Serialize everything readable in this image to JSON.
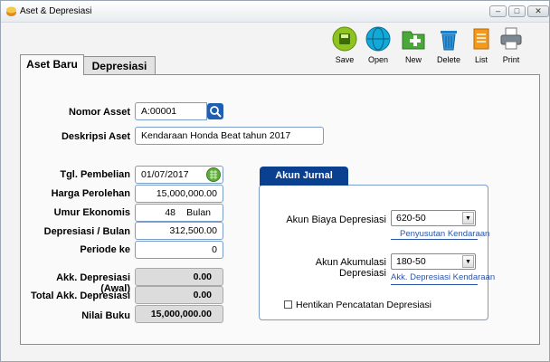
{
  "window": {
    "title": "Aset & Depresiasi"
  },
  "toolbar": {
    "save": "Save",
    "open": "Open",
    "new": "New",
    "delete": "Delete",
    "list": "List",
    "print": "Print"
  },
  "tabs": {
    "aset_baru": "Aset Baru",
    "depresiasi": "Depresiasi"
  },
  "form": {
    "nomor_asset": {
      "label": "Nomor Asset",
      "value": "A:00001"
    },
    "deskripsi_aset": {
      "label": "Deskripsi Aset",
      "value": "Kendaraan Honda Beat tahun 2017"
    },
    "tgl_pembelian": {
      "label": "Tgl. Pembelian",
      "value": "01/07/2017"
    },
    "harga_perolehan": {
      "label": "Harga Perolehan",
      "value": "15,000,000.00"
    },
    "umur_ekonomis": {
      "label": "Umur Ekonomis",
      "value": "48",
      "unit": "Bulan"
    },
    "depresiasi_bulan": {
      "label": "Depresiasi / Bulan",
      "value": "312,500.00"
    },
    "periode_ke": {
      "label": "Periode ke",
      "value": "0"
    },
    "akk_depresiasi_awal": {
      "label": "Akk. Depresiasi (Awal)",
      "value": "0.00"
    },
    "total_akk_depresiasi": {
      "label": "Total Akk. Depresiasi",
      "value": "0.00"
    },
    "nilai_buku": {
      "label": "Nilai Buku",
      "value": "15,000,000.00"
    }
  },
  "akun_jurnal": {
    "tab_label": "Akun Jurnal",
    "biaya": {
      "label": "Akun Biaya Depresiasi",
      "value": "620-50",
      "desc": "Penyusutan Kendaraan"
    },
    "akumulasi": {
      "label": "Akun Akumulasi Depresiasi",
      "value": "180-50",
      "desc": "Akk. Depresiasi Kendaraan"
    },
    "hentikan": {
      "label": "Hentikan Pencatatan Depresiasi",
      "checked": false
    }
  },
  "colors": {
    "jurnal_tab": "#0b3f8f",
    "link_text": "#2a55a8",
    "field_border": "#7a9cc6"
  },
  "icons": {
    "save": "save-disk-icon",
    "open": "open-globe-icon",
    "new": "new-folder-plus-icon",
    "delete": "trash-icon",
    "list": "list-doc-icon",
    "print": "printer-icon",
    "search": "search-icon",
    "calendar": "calendar-icon"
  }
}
